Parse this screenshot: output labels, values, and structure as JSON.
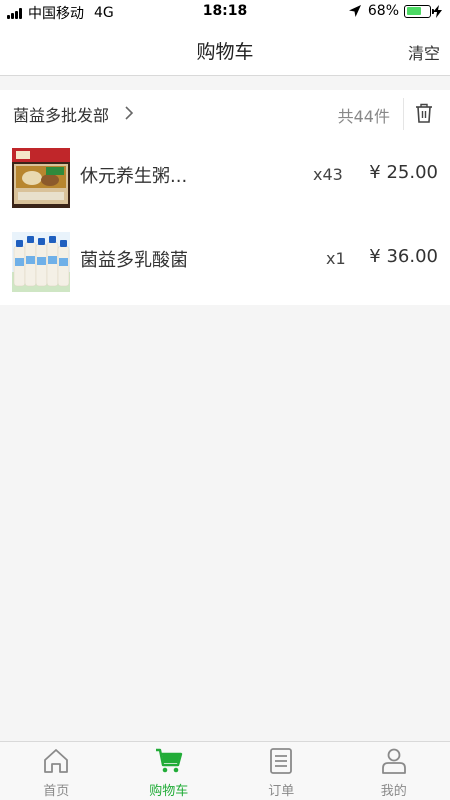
{
  "status_bar": {
    "carrier": "中国移动",
    "network": "4G",
    "time": "18:18",
    "battery": "68%",
    "battery_level": 0.68
  },
  "nav": {
    "title": "购物车",
    "clear_label": "清空"
  },
  "shop": {
    "name": "菌益多批发部",
    "count": "共44件",
    "items": [
      {
        "name": "休元养生粥...",
        "qty": "x43",
        "price": "¥ 25.00"
      },
      {
        "name": "菌益多乳酸菌",
        "qty": "x1",
        "price": "¥ 36.00"
      }
    ]
  },
  "tabs": [
    {
      "label": "首页",
      "icon": "home-icon"
    },
    {
      "label": "购物车",
      "icon": "cart-icon"
    },
    {
      "label": "订单",
      "icon": "order-list-icon"
    },
    {
      "label": "我的",
      "icon": "user-icon"
    }
  ],
  "active_tab": 1,
  "colors": {
    "accent": "#22ac38",
    "inactive": "#8a8a8a",
    "battery": "#4cd964"
  }
}
